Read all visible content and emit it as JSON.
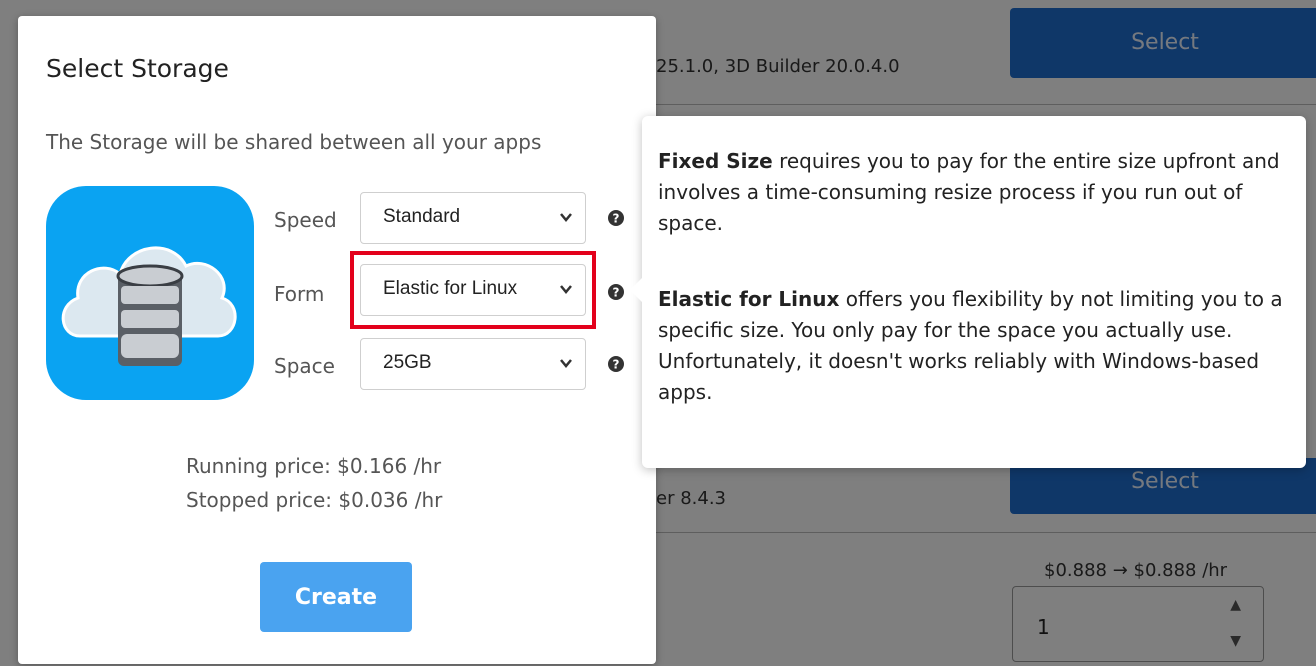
{
  "background": {
    "version_text": "25.1.0, 3D Builder 20.0.4.0",
    "version_text_2": "er 8.4.3",
    "select_label": "Select",
    "price_text": "$0.888 → $0.888 /hr",
    "quantity_value": "1"
  },
  "modal": {
    "title": "Select Storage",
    "subtitle": "The Storage will be shared between all your apps",
    "icon": "cloud-database-icon",
    "fields": {
      "speed": {
        "label": "Speed",
        "value": "Standard"
      },
      "form": {
        "label": "Form",
        "value": "Elastic for Linux"
      },
      "space": {
        "label": "Space",
        "value": "25GB"
      }
    },
    "running_price": "Running price:  $0.166 /hr",
    "stopped_price": "Stopped price:  $0.036 /hr",
    "create_label": "Create"
  },
  "tooltip": {
    "fixed_term": "Fixed Size",
    "fixed_desc": " requires you to pay for the entire size upfront and involves a time-consuming resize process if you run out of space.",
    "elastic_term": "Elastic for Linux",
    "elastic_desc": " offers you flexibility by not limiting you to a specific size. You only pay for the space you actually use. Unfortunately, it doesn't works reliably with Windows-based apps."
  },
  "colors": {
    "accent": "#4aa3f0",
    "highlight": "#e3001b",
    "bg_button": "#1f6fd1"
  }
}
